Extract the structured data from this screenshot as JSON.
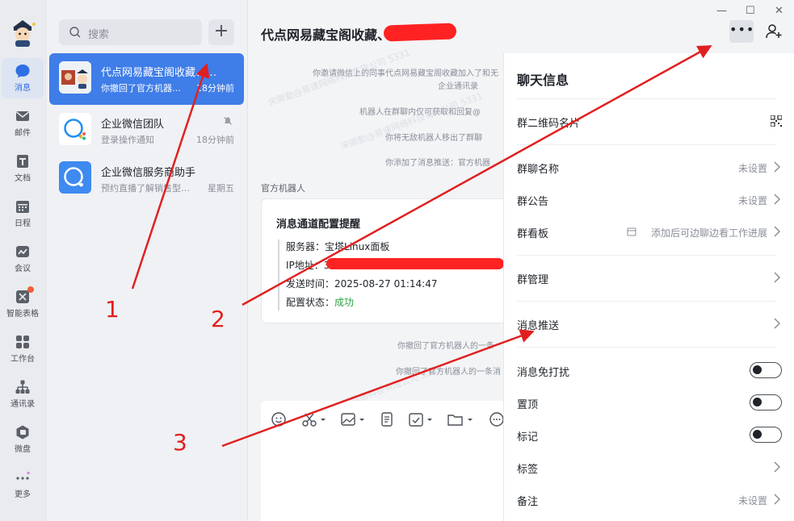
{
  "rail": {
    "items": [
      {
        "label": "消息",
        "icon": "chat-bubble-icon"
      },
      {
        "label": "邮件",
        "icon": "mail-icon"
      },
      {
        "label": "文档",
        "icon": "document-icon"
      },
      {
        "label": "日程",
        "icon": "calendar-icon"
      },
      {
        "label": "会议",
        "icon": "meeting-icon"
      },
      {
        "label": "智能表格",
        "icon": "smart-table-icon"
      },
      {
        "label": "工作台",
        "icon": "workbench-icon"
      },
      {
        "label": "通讯录",
        "icon": "contacts-icon"
      },
      {
        "label": "微盘",
        "icon": "drive-icon"
      },
      {
        "label": "更多",
        "icon": "more-icon"
      }
    ]
  },
  "search": {
    "placeholder": "搜索"
  },
  "conversations": [
    {
      "title": "代点网易藏宝阁收藏、代…",
      "subtitle": "你撤回了官方机器…",
      "time": "18分钟前",
      "active": true
    },
    {
      "title": "企业微信团队",
      "subtitle": "登录操作通知",
      "time": "18分钟前",
      "muted": true
    },
    {
      "title": "企业微信服务商助手",
      "subtitle": "预约直播了解销售型…",
      "time": "星期五"
    }
  ],
  "chat": {
    "title": "代点网易藏宝阁收藏、",
    "system_messages": [
      "你邀请微信上的同事代点网易藏宝阁收藏加入了和无",
      "企业通讯录",
      "机器人在群聊内仅可获取和回复@",
      "你将无敌机器人移出了群聊",
      "你添加了消息推送：官方机器"
    ],
    "sender": "官方机器人",
    "card": {
      "title": "消息通道配置提醒",
      "server_label": "服务器：",
      "server_value": "宝塔Linux面板",
      "ip_label": "IP地址：",
      "ip_value": "3",
      "time_label": "发送时间：",
      "time_value": "2025-08-27 01:14:47",
      "status_label": "配置状态：",
      "status_value": "成功"
    },
    "recall_messages": [
      "你撤回了官方机器人的一条",
      "你撤回了官方机器人的一条消"
    ],
    "watermark": "宋卿勤@易速网络科技有限公司 5331"
  },
  "panel": {
    "title": "聊天信息",
    "rows": {
      "qr": {
        "label": "群二维码名片"
      },
      "name": {
        "label": "群聊名称",
        "value": "未设置"
      },
      "notice": {
        "label": "群公告",
        "value": "未设置"
      },
      "board": {
        "label": "群看板",
        "value": "添加后可边聊边看工作进展"
      },
      "manage": {
        "label": "群管理"
      },
      "push": {
        "label": "消息推送"
      },
      "dnd": {
        "label": "消息免打扰",
        "on": false
      },
      "pin": {
        "label": "置顶",
        "on": false
      },
      "mark": {
        "label": "标记",
        "on": false
      },
      "tags": {
        "label": "标签"
      },
      "remark": {
        "label": "备注",
        "value": "未设置"
      }
    }
  },
  "annotations": {
    "n1": "1",
    "n2": "2",
    "n3": "3"
  },
  "colors": {
    "accent": "#3f7de8",
    "annotation": "#e02020",
    "success": "#2ba245"
  }
}
